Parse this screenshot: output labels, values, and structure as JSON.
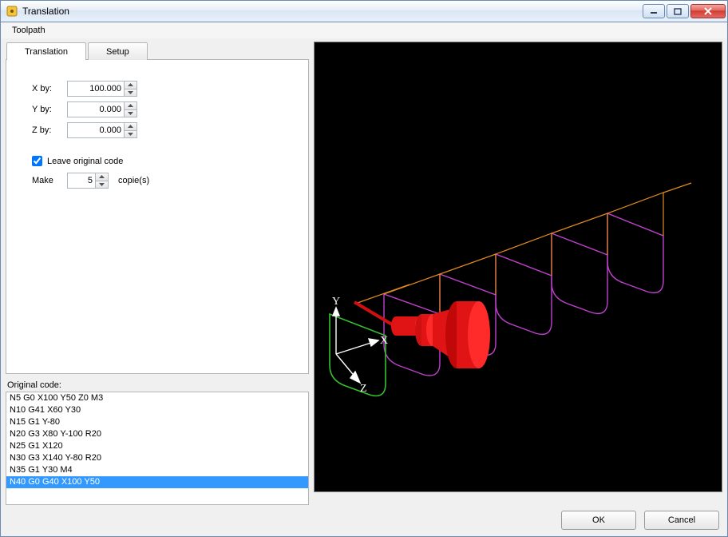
{
  "window": {
    "title": "Translation"
  },
  "menu": {
    "toolpath": "Toolpath"
  },
  "tabs": {
    "translation": "Translation",
    "setup": "Setup"
  },
  "form": {
    "xby_label": "X by:",
    "yby_label": "Y by:",
    "zby_label": "Z by:",
    "xby": "100.000",
    "yby": "0.000",
    "zby": "0.000",
    "leave_original": "Leave original code",
    "make_label": "Make",
    "copies_value": "5",
    "copies_suffix": "copie(s)"
  },
  "original_code": {
    "label": "Original code:",
    "lines": [
      "N5 G0 X100 Y50 Z0 M3",
      "N10 G41 X60 Y30",
      "N15 G1 Y-80",
      "N20 G3 X80 Y-100 R20",
      "N25 G1 X120",
      "N30 G3 X140 Y-80 R20",
      "N35 G1 Y30 M4",
      "N40 G0 G40 X100 Y50"
    ],
    "selected_index": 7
  },
  "axes": {
    "x": "X",
    "y": "Y",
    "z": "Z"
  },
  "buttons": {
    "ok": "OK",
    "cancel": "Cancel"
  }
}
